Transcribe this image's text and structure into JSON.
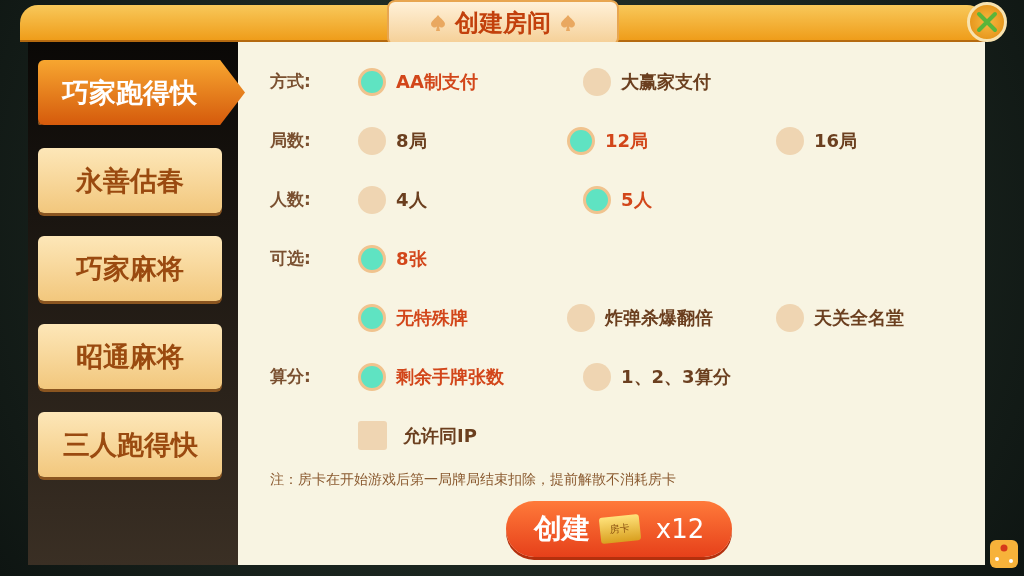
{
  "dialog": {
    "title": "创建房间"
  },
  "games": [
    {
      "label": "巧家跑得快",
      "selected": true
    },
    {
      "label": "永善估春",
      "selected": false
    },
    {
      "label": "巧家麻将",
      "selected": false
    },
    {
      "label": "昭通麻将",
      "selected": false
    },
    {
      "label": "三人跑得快",
      "selected": false
    }
  ],
  "options": [
    {
      "kind": "radio",
      "label": "方式:",
      "choices": [
        {
          "label": "AA制支付",
          "selected": true
        },
        {
          "label": "大赢家支付",
          "selected": false
        }
      ]
    },
    {
      "kind": "radio",
      "label": "局数:",
      "choices": [
        {
          "label": "8局",
          "selected": false
        },
        {
          "label": "12局",
          "selected": true
        },
        {
          "label": "16局",
          "selected": false
        }
      ]
    },
    {
      "kind": "radio",
      "label": "人数:",
      "choices": [
        {
          "label": "4人",
          "selected": false
        },
        {
          "label": "5人",
          "selected": true
        }
      ]
    },
    {
      "kind": "radio",
      "label": "可选:",
      "choices": [
        {
          "label": "8张",
          "selected": true
        }
      ]
    },
    {
      "kind": "radio",
      "choices": [
        {
          "label": "无特殊牌",
          "selected": true
        },
        {
          "label": "炸弹杀爆翻倍",
          "selected": false
        },
        {
          "label": "天关全名堂",
          "selected": false
        }
      ]
    },
    {
      "kind": "radio",
      "label": "算分:",
      "choices": [
        {
          "label": "剩余手牌张数",
          "selected": true
        },
        {
          "label": "1、2、3算分",
          "selected": false
        }
      ]
    },
    {
      "kind": "checkbox",
      "label_text": "允许同IP",
      "checked": false
    }
  ],
  "note": "注：房卡在开始游戏后第一局牌局结束扣除，提前解散不消耗房卡",
  "create_button": {
    "label": "创建",
    "card_label": "房卡",
    "cost": "x12"
  }
}
